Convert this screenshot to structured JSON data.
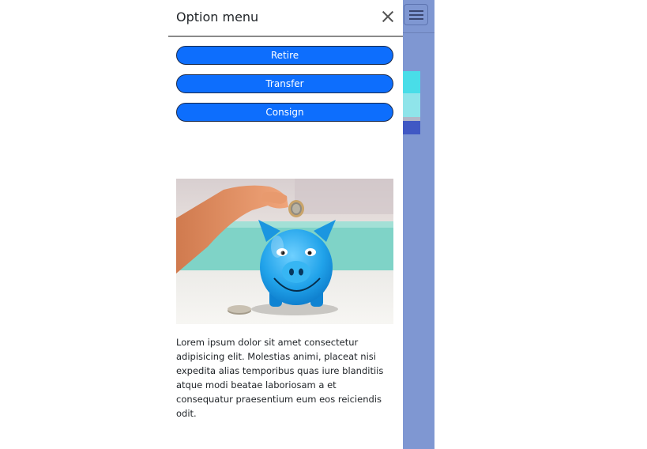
{
  "offcanvas": {
    "title": "Option menu",
    "close_icon": "close-icon",
    "buttons": [
      {
        "label": "Retire"
      },
      {
        "label": "Transfer"
      },
      {
        "label": "Consign"
      }
    ],
    "image": {
      "subject": "hand dropping a coin into a blue piggy bank"
    },
    "body_text": "Lorem ipsum dolor sit amet consectetur adipisicing elit. Molestias animi, placeat nisi expedita alias temporibus quas iure blanditiis atque modi beatae laboriosam a et consequatur praesentium eum eos reiciendis odit."
  },
  "background_page": {
    "toggler_icon": "hamburger-menu-icon",
    "overlay_color": "#7f97d2"
  },
  "colors": {
    "button": "#0d6efd",
    "button_border": "#1b2a4a",
    "piggy": "#29a9ea"
  }
}
